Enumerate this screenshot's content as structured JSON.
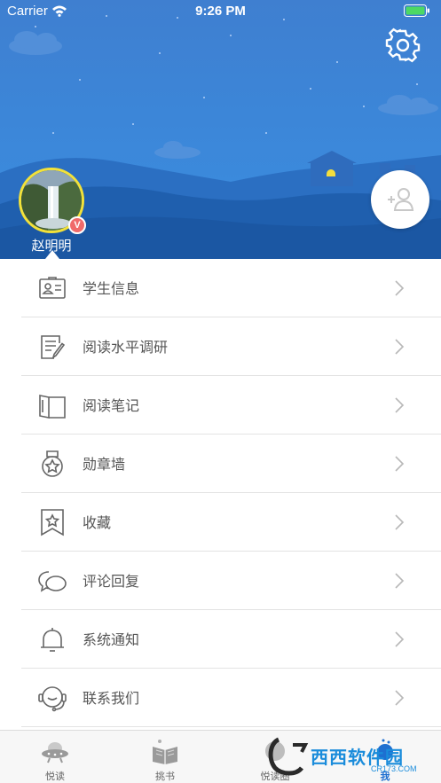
{
  "status_bar": {
    "carrier": "Carrier",
    "time": "9:26 PM"
  },
  "profile": {
    "name": "赵明明",
    "badge": "V"
  },
  "menu": [
    {
      "label": "学生信息",
      "icon": "id-card-icon"
    },
    {
      "label": "阅读水平调研",
      "icon": "survey-edit-icon"
    },
    {
      "label": "阅读笔记",
      "icon": "notebook-icon"
    },
    {
      "label": "勋章墙",
      "icon": "medal-icon"
    },
    {
      "label": "收藏",
      "icon": "bookmark-star-icon"
    },
    {
      "label": "评论回复",
      "icon": "chat-bubbles-icon"
    },
    {
      "label": "系统通知",
      "icon": "bell-icon"
    },
    {
      "label": "联系我们",
      "icon": "headset-icon"
    }
  ],
  "tabs": [
    {
      "label": "悦读",
      "icon": "ufo-icon"
    },
    {
      "label": "挑书",
      "icon": "book-stack-icon"
    },
    {
      "label": "悦读圈",
      "icon": "circle-icon"
    },
    {
      "label": "我",
      "icon": "profile-icon",
      "active": true
    }
  ],
  "watermark": {
    "main": "西西软件园",
    "sub": "CR173.COM"
  },
  "colors": {
    "header_blue": "#3c86d8",
    "accent": "#1e6fd0",
    "avatar_ring": "#f2e13a",
    "vip_badge": "#f06a6a"
  }
}
